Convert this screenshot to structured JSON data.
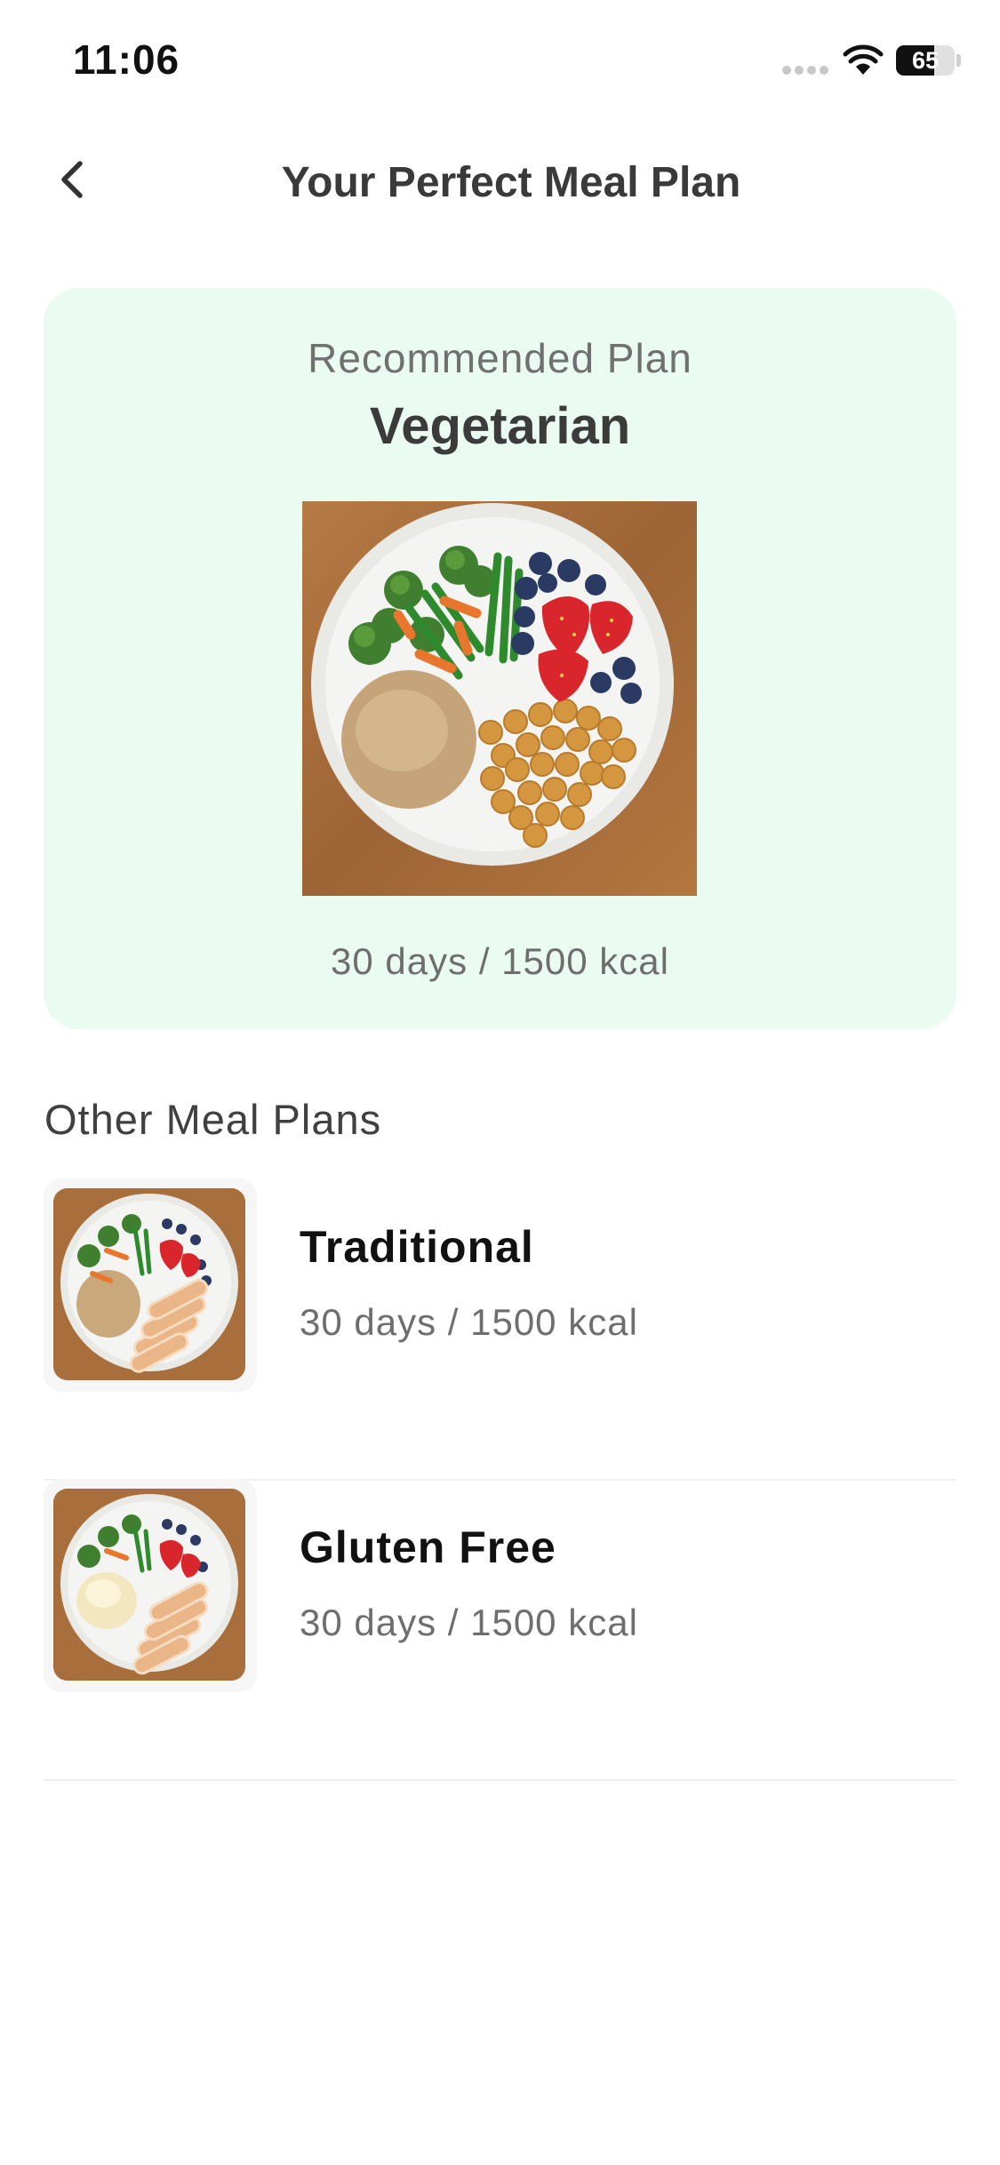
{
  "status_bar": {
    "time": "11:06",
    "battery_percent": 65,
    "battery_label": "65",
    "icons": [
      "cellular-signal-icon",
      "wifi-icon",
      "battery-icon"
    ]
  },
  "header": {
    "back_icon": "chevron-left-icon",
    "title": "Your Perfect Meal Plan"
  },
  "recommended": {
    "label": "Recommended Plan",
    "name": "Vegetarian",
    "meta": "30 days / 1500 kcal"
  },
  "other_plans": {
    "title": "Other Meal Plans",
    "items": [
      {
        "name": "Traditional",
        "meta": "30 days / 1500 kcal"
      },
      {
        "name": "Gluten Free",
        "meta": "30 days / 1500 kcal"
      }
    ]
  },
  "colors": {
    "card_background": "#eafcf2",
    "text_primary": "#333333",
    "text_secondary": "#6e6e6e",
    "divider": "#f0f0f0"
  }
}
